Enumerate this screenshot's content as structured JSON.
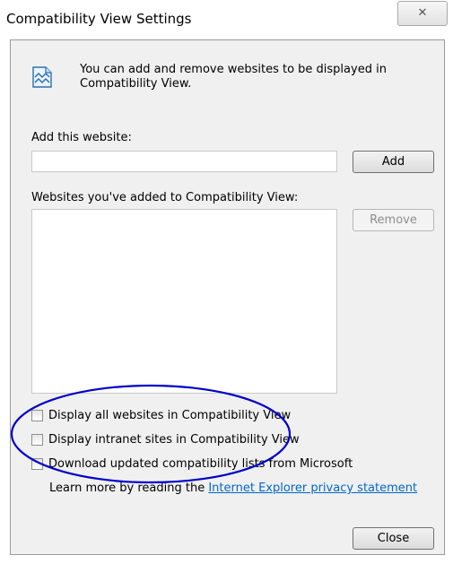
{
  "window": {
    "title": "Compatibility View Settings",
    "close_glyph": "✕"
  },
  "info": {
    "icon": "compatibility-view-icon",
    "text": "You can add and remove websites to be displayed in Compatibility View."
  },
  "add_website": {
    "label": "Add this website:",
    "value": "",
    "button_label": "Add"
  },
  "website_list": {
    "label": "Websites you've added to Compatibility View:",
    "items": [],
    "remove_label": "Remove"
  },
  "options": [
    {
      "label": "Display all websites in Compatibility View",
      "checked": false
    },
    {
      "label": "Display intranet sites in Compatibility View",
      "checked": false
    },
    {
      "label": "Download updated compatibility lists from Microsoft",
      "checked": false
    }
  ],
  "privacy": {
    "prefix": "Learn more by reading the ",
    "link_text": "Internet Explorer privacy statement"
  },
  "footer": {
    "close_label": "Close"
  },
  "colors": {
    "annotation": "#0000cc",
    "link": "#0066cc"
  }
}
